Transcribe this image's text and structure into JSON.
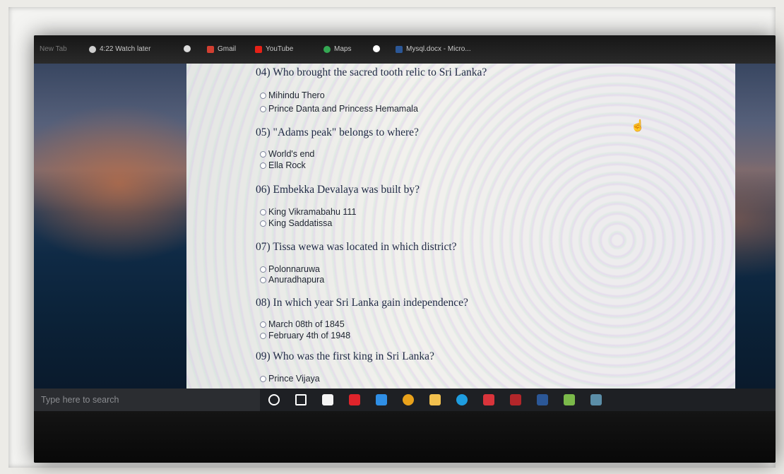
{
  "bookmarks_bar": {
    "items": [
      {
        "label": "New Tab",
        "icon": "tab-icon",
        "color": "#666666"
      },
      {
        "label": "4:22 Watch later",
        "icon": "clock-icon",
        "color": "#cccccc"
      },
      {
        "label": "",
        "icon": "globe-icon",
        "color": "#dddddd"
      },
      {
        "label": "Gmail",
        "icon": "gmail-icon",
        "color": "#d23f31"
      },
      {
        "label": "YouTube",
        "icon": "youtube-icon",
        "color": "#e62117"
      },
      {
        "label": "Maps",
        "icon": "maps-icon",
        "color": "#34a853"
      },
      {
        "label": "",
        "icon": "google-icon",
        "color": "#ffffff"
      },
      {
        "label": "Mysql.docx - Micro...",
        "icon": "word-icon",
        "color": "#2b5797"
      }
    ]
  },
  "quiz": {
    "questions": [
      {
        "text": "04) Who brought the sacred tooth relic to Sri Lanka?",
        "options": [
          "Mihindu Thero",
          "Prince Danta and Princess Hemamala"
        ]
      },
      {
        "text": "05) \"Adams peak\" belongs to where?",
        "options": [
          "World's end",
          "Ella Rock"
        ]
      },
      {
        "text": "06) Embekka Devalaya was built by?",
        "options": [
          "King Vikramabahu 111",
          "King Saddatissa"
        ]
      },
      {
        "text": "07) Tissa wewa was located in which district?",
        "options": [
          "Polonnaruwa",
          "Anuradhapura"
        ]
      },
      {
        "text": "08) In which year Sri Lanka gain independence?",
        "options": [
          "March 08th of 1845",
          "February 4th of 1948"
        ]
      },
      {
        "text": "09) Who was the first king in Sri Lanka?",
        "options": [
          "Prince Vijaya"
        ]
      }
    ]
  },
  "taskbar": {
    "search_placeholder": "Type here to search",
    "icons": [
      {
        "name": "cortana-icon",
        "color": "#ffffff"
      },
      {
        "name": "task-view-icon",
        "color": "#ffffff"
      },
      {
        "name": "store-icon",
        "color": "#f4f4f4"
      },
      {
        "name": "umbrella-icon",
        "color": "#e0242b"
      },
      {
        "name": "mail-icon",
        "color": "#2f8fe6"
      },
      {
        "name": "chrome-icon",
        "color": "#e9a21b"
      },
      {
        "name": "file-explorer-icon",
        "color": "#f2c04e"
      },
      {
        "name": "edge-icon",
        "color": "#1e9de0"
      },
      {
        "name": "app-icon",
        "color": "#d9343b"
      },
      {
        "name": "filezilla-icon",
        "color": "#b3262a"
      },
      {
        "name": "word-icon",
        "color": "#2b5797"
      },
      {
        "name": "notepad-icon",
        "color": "#7bb94a"
      },
      {
        "name": "app-icon-2",
        "color": "#5b8ea8"
      }
    ]
  }
}
